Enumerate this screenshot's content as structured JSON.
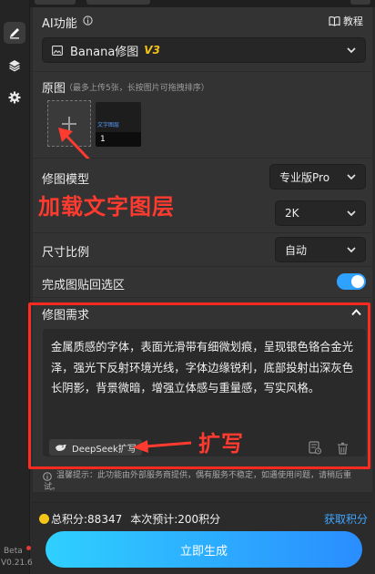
{
  "header": {
    "ai_feature_label": "AI功能",
    "tutorial_label": "教程"
  },
  "model_select": {
    "value": "Banana修图",
    "badge": "V3"
  },
  "original": {
    "label": "原图",
    "hint": "（最多上传5张，长按图片可拖拽排序）",
    "images": [
      {
        "preview_text": "文字图层",
        "index": "1"
      }
    ]
  },
  "annotations": {
    "load_text_layer": "加载文字图层",
    "expand": "扩写"
  },
  "retouch_model": {
    "label": "修图模型",
    "value": "专业版Pro"
  },
  "resolution": {
    "value": "2K"
  },
  "size_ratio": {
    "label": "尺寸比例",
    "value": "自动"
  },
  "paste_back": {
    "label": "完成图贴回选区",
    "enabled": true
  },
  "requirements": {
    "label": "修图需求",
    "text": "金属质感的字体，表面光滑带有细微划痕，呈现银色铬合金光泽，强光下反射环境光线，字体边缘锐利，底部投射出深灰色长阴影，背景微暗，增强立体感与重量感，写实风格。",
    "deepseek_label": "DeepSeek扩写"
  },
  "tip": {
    "text": "温馨提示：此功能由外部服务商提供，偶有服务不稳定，如遇使用问题，请稍后重试。"
  },
  "footer": {
    "total_points": "总积分:88347",
    "estimate": "本次预计:200积分",
    "earn_points": "获取积分",
    "generate_button": "立即生成"
  },
  "rail": {
    "beta": "Beta",
    "version": "V0.21.6"
  },
  "colors": {
    "accent": "#2a8dff",
    "annotation_red": "#ff3a2f",
    "coin": "#f5c518"
  }
}
